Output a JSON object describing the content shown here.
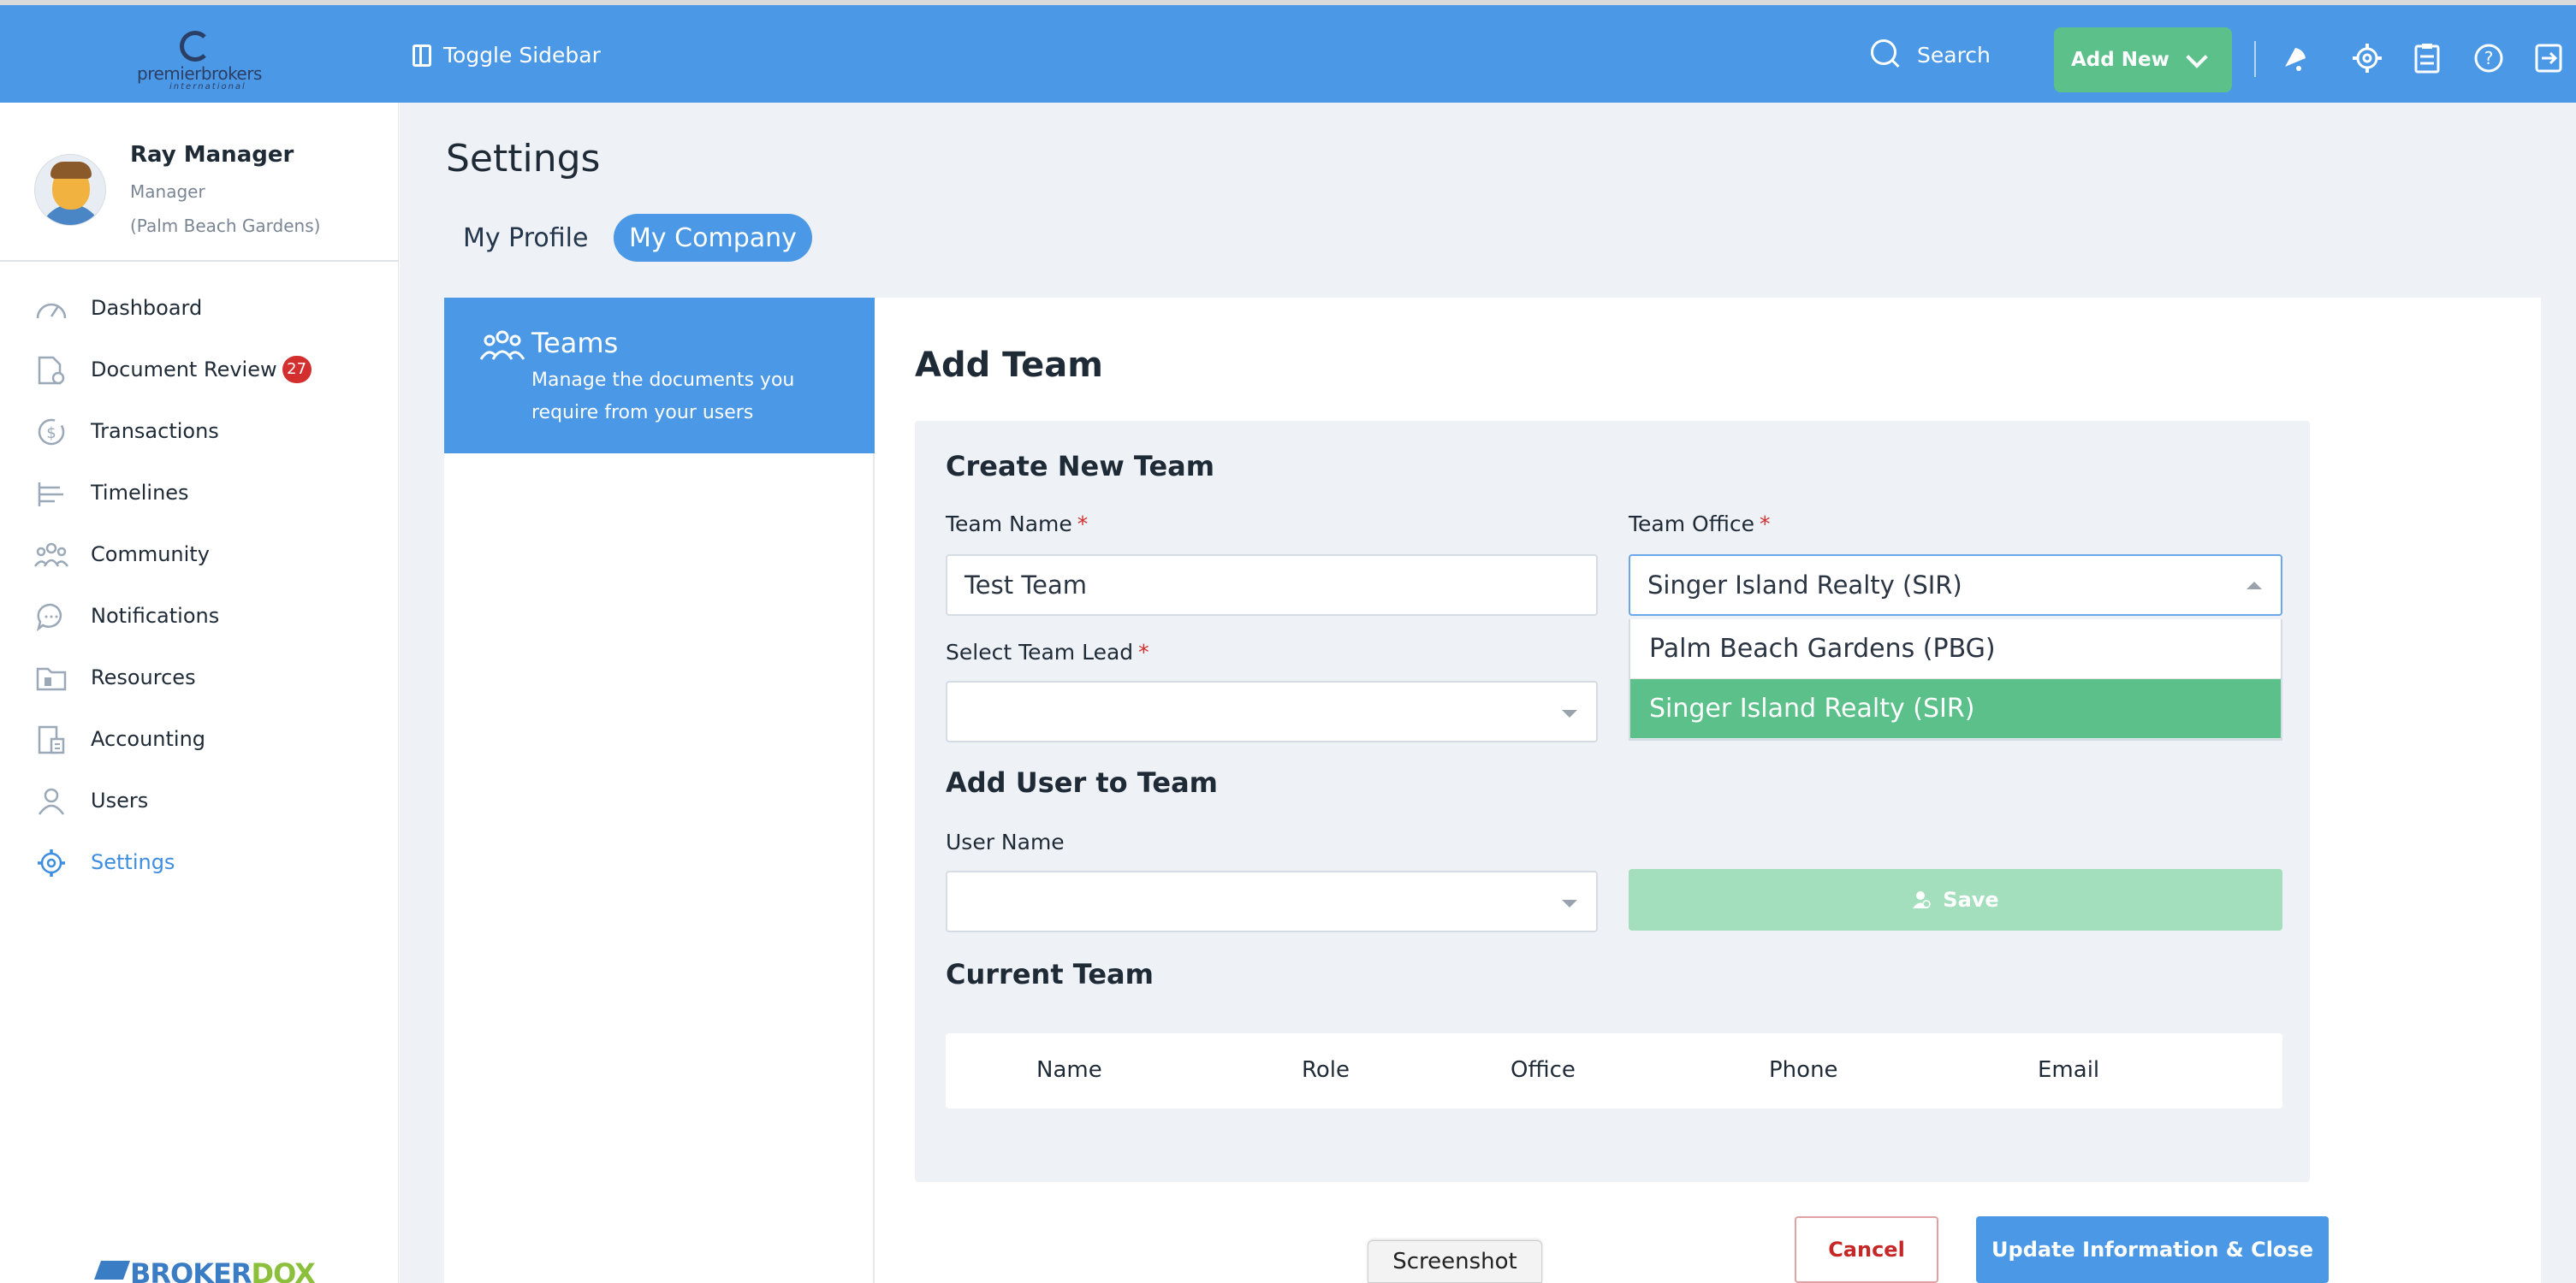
{
  "brand": {
    "logo_main": "premierbrokers",
    "logo_sub": "international",
    "bottom_logo_a": "BROKER",
    "bottom_logo_b": "DOX"
  },
  "topbar": {
    "toggle_label": "Toggle Sidebar",
    "search_label": "Search",
    "add_new_label": "Add New",
    "icons": [
      "bell-icon",
      "gear-icon",
      "clipboard-icon",
      "help-icon",
      "logout-icon"
    ]
  },
  "user": {
    "name": "Ray Manager",
    "role": "Manager",
    "office": "(Palm Beach Gardens)"
  },
  "sidebar": {
    "items": [
      {
        "label": "Dashboard",
        "icon": "gauge-icon"
      },
      {
        "label": "Document Review",
        "icon": "document-check-icon",
        "badge": "27"
      },
      {
        "label": "Transactions",
        "icon": "dollar-icon"
      },
      {
        "label": "Timelines",
        "icon": "timeline-icon"
      },
      {
        "label": "Community",
        "icon": "people-icon"
      },
      {
        "label": "Notifications",
        "icon": "chat-icon"
      },
      {
        "label": "Resources",
        "icon": "folder-icon"
      },
      {
        "label": "Accounting",
        "icon": "ledger-icon"
      },
      {
        "label": "Users",
        "icon": "user-icon"
      },
      {
        "label": "Settings",
        "icon": "gear-icon",
        "active": true
      }
    ]
  },
  "page": {
    "title": "Settings",
    "tabs": [
      "My Profile",
      "My Company"
    ],
    "active_tab": "My Company"
  },
  "left_panel": {
    "title": "Teams",
    "description": "Manage the documents you require from your users"
  },
  "form": {
    "title": "Add Team",
    "create_section": "Create New Team",
    "team_name_label": "Team Name",
    "team_name_value": "Test Team",
    "team_office_label": "Team Office",
    "team_office_value": "Singer Island Realty (SIR)",
    "team_office_options": [
      "Palm Beach Gardens (PBG)",
      "Singer Island Realty (SIR)"
    ],
    "team_lead_label": "Select Team Lead",
    "team_lead_value": "",
    "add_user_section": "Add User to Team",
    "user_name_label": "User Name",
    "user_name_value": "",
    "save_label": "Save",
    "current_team_section": "Current Team",
    "columns": [
      "Name",
      "Role",
      "Office",
      "Phone",
      "Email"
    ],
    "required_mark": "*"
  },
  "actions": {
    "cancel_label": "Cancel",
    "update_label": "Update Information & Close"
  },
  "overlay": {
    "tooltip": "Screenshot"
  },
  "colors": {
    "primary": "#4a98e6",
    "success": "#5cc08b",
    "danger": "#c62828",
    "badge": "#d32f2f"
  }
}
